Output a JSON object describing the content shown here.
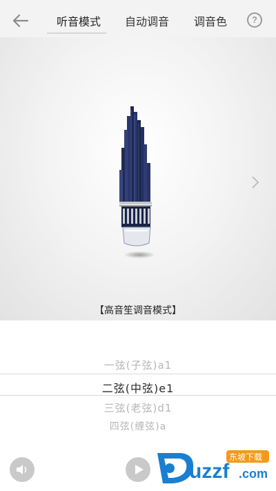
{
  "header": {
    "tabs": [
      {
        "label": "听音模式",
        "active": true
      },
      {
        "label": "自动调音",
        "active": false
      },
      {
        "label": "调音色",
        "active": false
      }
    ],
    "help_symbol": "?"
  },
  "icons": {
    "back": "arrow-left-icon",
    "help": "question-circle-icon",
    "next": "chevron-right-icon",
    "volume": "speaker-icon",
    "play": "play-icon"
  },
  "stage": {
    "mode_label": "【高音笙调音模式】"
  },
  "strings": [
    {
      "label": "一弦(子弦)a1",
      "selected": false
    },
    {
      "label": "二弦(中弦)e1",
      "selected": true
    },
    {
      "label": "三弦(老弦)d1",
      "selected": false
    },
    {
      "label": "四弦(缠弦)a",
      "selected": false
    }
  ],
  "watermark": {
    "brand": "uzzf",
    "tld": ".com",
    "tagline": "东坡下载"
  },
  "colors": {
    "header_bg": "#f3f3f3",
    "instrument": "#1f2a55",
    "watermark_blue": "#1a7fd0",
    "watermark_orange": "#f39a1a"
  }
}
